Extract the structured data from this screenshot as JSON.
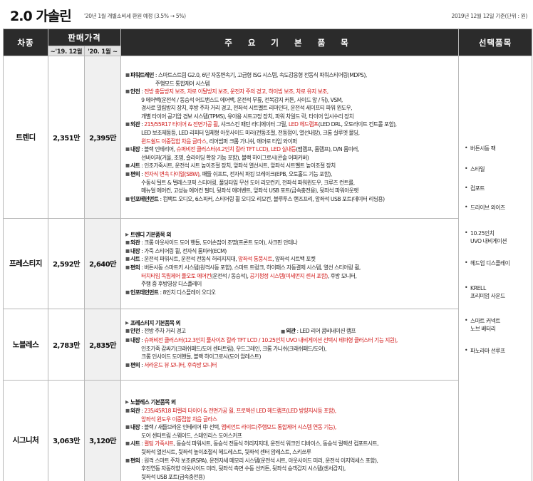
{
  "header": {
    "title": "2.0 가솔린",
    "subtitle": "'20년 1월 개별소비세 환원 예정 (3.5% → 5%)",
    "basis": "2019년 12월 12일 기준(단위 : 원)"
  },
  "columns": {
    "trim": "차종",
    "price": "판매가격",
    "spec": "주 요 기 본 품 목",
    "options": "선택품목",
    "price_19": "~'19. 12월",
    "price_20": "'20. 1월 ~"
  },
  "options": [
    [
      "버튼시동 팩"
    ],
    [
      "스타일"
    ],
    [
      "컴포트"
    ],
    [
      "드라이브 와이즈"
    ],
    [
      "10.25인치",
      "UVO 내비게이션"
    ],
    [
      "헤드업 디스플레이"
    ],
    [
      "KRELL",
      "프리미엄 사운드"
    ],
    [
      "스마트 커넥트",
      "노브 배터리"
    ],
    [
      "파노라마 선루프"
    ]
  ],
  "trims": [
    {
      "name": "트렌디",
      "price_19": "2,351만",
      "price_20": "2,395만",
      "specs": [
        {
          "cat": "파워트레인",
          "lines": [
            [
              {
                "t": ": 스마트스트림 G2.0, 6단 자동변속기, 고급형 ISG 시스템, 속도감응형 전동식 파워스티어링(MDPS),"
              }
            ],
            [
              {
                "t": "주행모드 통합제어 시스템"
              }
            ]
          ]
        },
        {
          "cat": "안전",
          "lines": [
            [
              {
                "t": ": "
              },
              {
                "t": "전방 충돌방지 보조, 차로 이탈방지 보조, 운전자 주의 경고, 하이빔 보조, 차로 유지 보조,",
                "r": true
              }
            ],
            [
              {
                "t": "9 에어백(운전석 / 동승석 어드밴스드 에어백, 운전석 무릎, 전복감지 커튼, 사이드 앞 / 뒤), VSM,"
              }
            ],
            [
              {
                "t": "경사로 밀림방지 장치, 후방 주차 거리 경고, 전좌석 시트벨트 리마인더, 운전석 세이프티 파워 윈도우,"
              }
            ],
            [
              {
                "t": "개별 타이어 공기압 경보 시스템(TPMS), 유아용 시트고정 장치, 파워 차일드 락, 타이어 임시수리 장치"
              }
            ]
          ]
        },
        {
          "cat": "외관",
          "lines": [
            [
              {
                "t": ": "
              },
              {
                "t": "215/55R17 타이어 & 전면가공 휠",
                "r": true
              },
              {
                "t": ", 샤크스킨 패턴 라디에이터 그릴, "
              },
              {
                "t": "LED 헤드램프",
                "r": true
              },
              {
                "t": "(LED DRL, 오토라이트 컨트롤 포함),"
              }
            ],
            [
              {
                "t": "LED 보조제동등, LED 리피터 일체형 아웃사이드 미러(전동조절, 전동접이, 열선내장), 크롬 실루엣 몰딩,"
              }
            ],
            [
              {
                "t": "윈드쉴드 이중접합 차음 글라스",
                "r": true
              },
              {
                "t": ", 리어범퍼 크롬 가니쉬, 에어로 타입 와이퍼"
              }
            ]
          ]
        },
        {
          "cat": "내장",
          "lines": [
            [
              {
                "t": ": 블랙 인테리어, "
              },
              {
                "t": "슈퍼비전 클러스터(4.2인치 칼라 TFT LCD), LED 실내등",
                "r": true
              },
              {
                "t": "(맵램프, 룸램프), D/N 룸미러,"
              }
            ],
            [
              {
                "t": "선바이저(거울, 조명, 슬라이딩 확장 기능 포함), 블랙 하이그로시(콘솔 어퍼커버)"
              }
            ]
          ]
        },
        {
          "cat": "시트",
          "lines": [
            [
              {
                "t": ": 인조가죽시트, 운전석 시트 높이조절 장치, 앞좌석 열선시트, 앞좌석 시트벨트 높이조절 장치"
              }
            ]
          ]
        },
        {
          "cat": "편의",
          "lines": [
            [
              {
                "t": ": "
              },
              {
                "t": "전자식 변속 다이얼(SBW)",
                "r": true
              },
              {
                "t": ", 패들 쉬프트, 전자식 파킹 브레이크(EPB, 오토홀드 기능 포함),"
              }
            ],
            [
              {
                "t": "수동식 틸트 & 텔레스코픽 스티어링, 풀딩타입 무선 도어 리모컨키, 전좌석 파워윈도우, 크루즈 컨트롤,"
              }
            ],
            [
              {
                "t": "매뉴얼 에어컨, 고성능 에어컨 필터, 뒷좌석 에어벤트, 앞좌석 USB 포트(급속충전용), 뒷좌석 파워아웃렛"
              }
            ]
          ]
        },
        {
          "cat": "인포테인먼트",
          "lines": [
            [
              {
                "t": ": 컴팩트 오디오, 6스피커, 스티어링 휠 오디오 리모컨, 블루투스 핸즈프리, 앞좌석 USB 포트(데이터 리딩용)"
              }
            ]
          ]
        }
      ]
    },
    {
      "name": "프레스티지",
      "price_19": "2,592만",
      "price_20": "2,640만",
      "base": "트렌디 기본품목 외",
      "specs": [
        {
          "cat": "외관",
          "lines": [
            [
              {
                "t": ": 크롬 아웃사이드 도어 핸들, 도어손잡이 조명(프론트 도어), 샤크핀 안테나"
              }
            ]
          ]
        },
        {
          "cat": "내장",
          "lines": [
            [
              {
                "t": ": 가죽 스티어링 휠, 전자식 룸미러(ECM)"
              }
            ]
          ]
        },
        {
          "cat": "시트",
          "lines": [
            [
              {
                "t": ": 운전석 파워시트, 운전석 전동식 허리지지대, "
              },
              {
                "t": "앞좌석 통풍시트",
                "r": true
              },
              {
                "t": ", 앞좌석 시트백 포켓"
              }
            ]
          ]
        },
        {
          "cat": "편의",
          "lines": [
            [
              {
                "t": ": 버튼시동 스마트키 시스템(원격시동 포함), 스마트 트렁크, 하이패스 자동결제 시스템, 열선 스티어링 휠,"
              }
            ],
            [
              {
                "t": "터치타입 독립제어 풀오토 에어컨",
                "r": true
              },
              {
                "t": "(운전석 / 동승석), "
              },
              {
                "t": "공기청정 시스템(미세먼지 센서 포함)",
                "r": true
              },
              {
                "t": ", 후방 모니터,"
              }
            ],
            [
              {
                "t": "주행 중 후방영상 디스플레이"
              }
            ]
          ]
        },
        {
          "cat": "인포테인먼트",
          "lines": [
            [
              {
                "t": ": 8인치 디스플레이 오디오"
              }
            ]
          ]
        }
      ]
    },
    {
      "name": "노블레스",
      "price_19": "2,783만",
      "price_20": "2,835만",
      "base": "프레스티지 기본품목 외",
      "specs": [
        {
          "cat": "안전",
          "cat2": "외관",
          "lines": [
            [
              {
                "t": ": 전방 주차 거리 경고"
              }
            ]
          ],
          "second": ": LED 리어 콤비네이션 램프"
        },
        {
          "cat": "내장",
          "lines": [
            [
              {
                "t": ": "
              },
              {
                "t": "슈퍼비전 클러스터(12.3인치 풀사이즈 칼라 TFT LCD / 10.25인치 UVO 내비게이션 선택시 테마형 클러스터 기능 지원),",
                "r": true
              }
            ],
            [
              {
                "t": "인조가죽 감싸기(크래쉬패드/도어 센터트림), 우드그레인, 크롬 가니쉬(크래쉬패드/도어),"
              }
            ],
            [
              {
                "t": "크롬 인사이드 도어핸들, 블랙 하이그로시(도어 암레스트)"
              }
            ]
          ]
        },
        {
          "cat": "편의",
          "lines": [
            [
              {
                "t": ": "
              },
              {
                "t": "서라운드 뷰 모니터, 후측방 모니터",
                "r": true
              }
            ]
          ]
        }
      ]
    },
    {
      "name": "시그니처",
      "price_19": "3,063만",
      "price_20": "3,120만",
      "base": "노블레스 기본품목 외",
      "specs": [
        {
          "cat": "외관",
          "lines": [
            [
              {
                "t": ": "
              },
              {
                "t": "235/45R18 피렐리 타이어 & 전면가공 휠, 프로젝션 LED 헤드램프(LED 방향지시등 포함),",
                "r": true
              }
            ],
            [
              {
                "t": "앞좌석 윈도우 이중접합 차음 글라스",
                "r": true
              }
            ]
          ]
        },
        {
          "cat": "내장",
          "lines": [
            [
              {
                "t": ": 블랙 / 새들브라운 인테리어 中 선택, "
              },
              {
                "t": "앰비언트 라이트(주행모드 통합제어 시스템 연동 기능),",
                "r": true
              }
            ],
            [
              {
                "t": "도어 센터트림 스웨이드, 스테인리스 도어스커프"
              }
            ]
          ]
        },
        {
          "cat": "시트",
          "lines": [
            [
              {
                "t": ": "
              },
              {
                "t": "퀼팅 가죽시트",
                "r": true
              },
              {
                "t": ", 동승석 파워시트, 동승석 전동식 허리지지대, 운전석 워크인 디바이스, 동승석 릴렉션 컴포트시트,"
              }
            ],
            [
              {
                "t": "뒷좌석 열선시트, 뒷좌석 높이조절식 헤드레스트, 뒷좌석 센터 암레스트, 스키쓰루"
              }
            ]
          ]
        },
        {
          "cat": "편의",
          "lines": [
            [
              {
                "t": ": 원격 스마트 주차 보조(RSPA), 운전자세 메모리 시스템(운전석 시트, 아웃사이드 미러, 운전석 이지억세스 포함),"
              }
            ],
            [
              {
                "t": "후진연동 자동하향 아웃사이드 미러, 뒷좌석 측면 수동 선커튼, 뒷좌석 승객감지 시스템(센서감지),"
              }
            ],
            [
              {
                "t": "뒷좌석 USB 포트(급속충전용)"
              }
            ]
          ]
        }
      ]
    }
  ]
}
